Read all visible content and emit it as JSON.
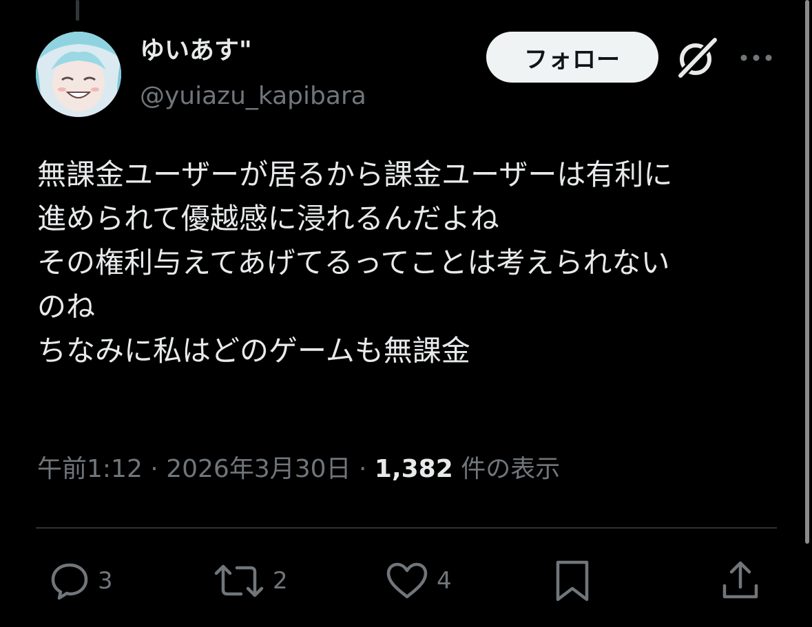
{
  "post": {
    "author": {
      "display_name": "ゆいあす\"",
      "handle": "@yuiazu_kapibara"
    },
    "follow_label": "フォロー",
    "text_lines": [
      "無課金ユーザーが居るから課金ユーザーは有利に",
      "進められて優越感に浸れるんだよね",
      "その権利与えてあげてるってことは考えられない",
      "のね",
      "ちなみに私はどのゲームも無課金"
    ],
    "timestamp": "午前1:12",
    "date": "2026年3月30日",
    "separator": "·",
    "views_count": "1,382",
    "views_label": "件の表示",
    "actions": {
      "reply_count": "3",
      "repost_count": "2",
      "like_count": "4"
    }
  },
  "icons": {
    "reply": "reply-icon",
    "repost": "repost-icon",
    "like": "heart-icon",
    "bookmark": "bookmark-icon",
    "share": "share-icon",
    "grok": "grok-icon",
    "more": "more-icon"
  },
  "colors": {
    "background": "#000000",
    "primary_text": "#e7e9ea",
    "secondary_text": "#71767b",
    "follow_button_bg": "#eff3f4",
    "divider": "#2f3336"
  }
}
